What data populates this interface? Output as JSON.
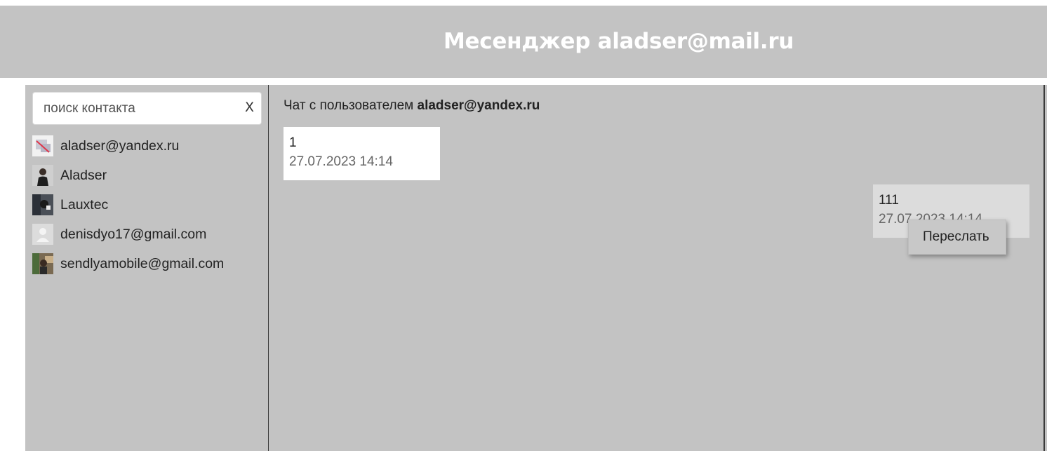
{
  "header": {
    "title": "Месенджер aladser@mail.ru"
  },
  "search": {
    "placeholder": "поиск контакта",
    "value": "",
    "clear_label": "X"
  },
  "contacts": [
    {
      "name": "aladser@yandex.ru",
      "avatar": "broken-image-icon"
    },
    {
      "name": "Aladser",
      "avatar": "user-photo"
    },
    {
      "name": "Lauxtec",
      "avatar": "user-photo"
    },
    {
      "name": "denisdyo17@gmail.com",
      "avatar": "default-user-icon"
    },
    {
      "name": "sendlyamobile@gmail.com",
      "avatar": "user-photo"
    }
  ],
  "chat": {
    "heading_prefix": "Чат с пользователем",
    "heading_user": "aladser@yandex.ru",
    "messages": [
      {
        "text": "1",
        "time": "27.07.2023 14:14",
        "direction": "incoming"
      },
      {
        "text": "111",
        "time": "27.07.2023 14:14",
        "direction": "outgoing"
      }
    ]
  },
  "context_menu": {
    "items": [
      "Переслать"
    ]
  },
  "colors": {
    "panel_bg": "#c3c3c3",
    "header_text": "#ffffff",
    "incoming_bubble": "#ffffff",
    "outgoing_bubble": "#dcdcdc"
  }
}
